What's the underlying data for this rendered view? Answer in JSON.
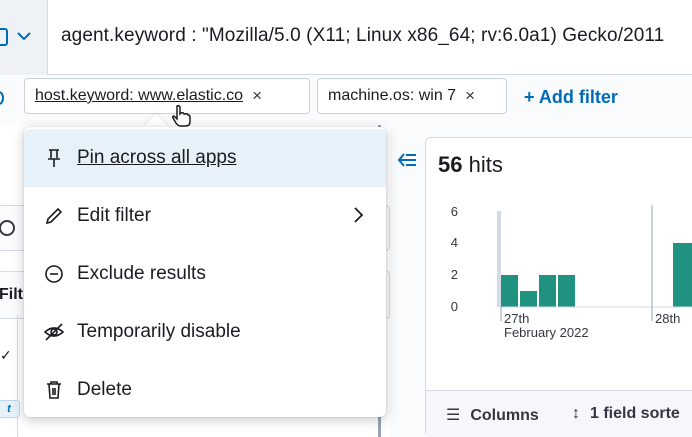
{
  "query": {
    "text": "agent.keyword : \"Mozilla/5.0 (X11; Linux x86_64; rv:6.0a1) Gecko/2011"
  },
  "filters": [
    {
      "label": "host.keyword: www.elastic.co",
      "remove": "×"
    },
    {
      "label": "machine.os: win 7",
      "remove": "×"
    }
  ],
  "add_filter_label": "+ Add filter",
  "sidebar": {
    "filter_label": "Filt",
    "check": "✓",
    "chip": "t"
  },
  "menu": {
    "items": [
      {
        "label": "Pin across all apps",
        "icon": "pin-icon"
      },
      {
        "label": "Edit filter",
        "icon": "pencil-icon"
      },
      {
        "label": "Exclude results",
        "icon": "minus-circle-icon"
      },
      {
        "label": "Temporarily disable",
        "icon": "eye-closed-icon"
      },
      {
        "label": "Delete",
        "icon": "trash-icon"
      }
    ]
  },
  "results": {
    "hits_count": "56",
    "hits_label": " hits"
  },
  "chart_data": {
    "type": "bar",
    "y_ticks": [
      "6",
      "4",
      "2",
      "0"
    ],
    "ylim": [
      0,
      6
    ],
    "x_tick_labels": [
      "27th",
      "28th"
    ],
    "x_sub_label": "February 2022",
    "bar_values": [
      2,
      1,
      2,
      2
    ],
    "right_bar_value": 4,
    "bar_color": "#209280"
  },
  "toolbar": {
    "columns_label": "Columns",
    "sort_label": "1 field sorte"
  },
  "colors": {
    "accent": "#006bb8",
    "menu_highlight": "#e6f1fa"
  }
}
